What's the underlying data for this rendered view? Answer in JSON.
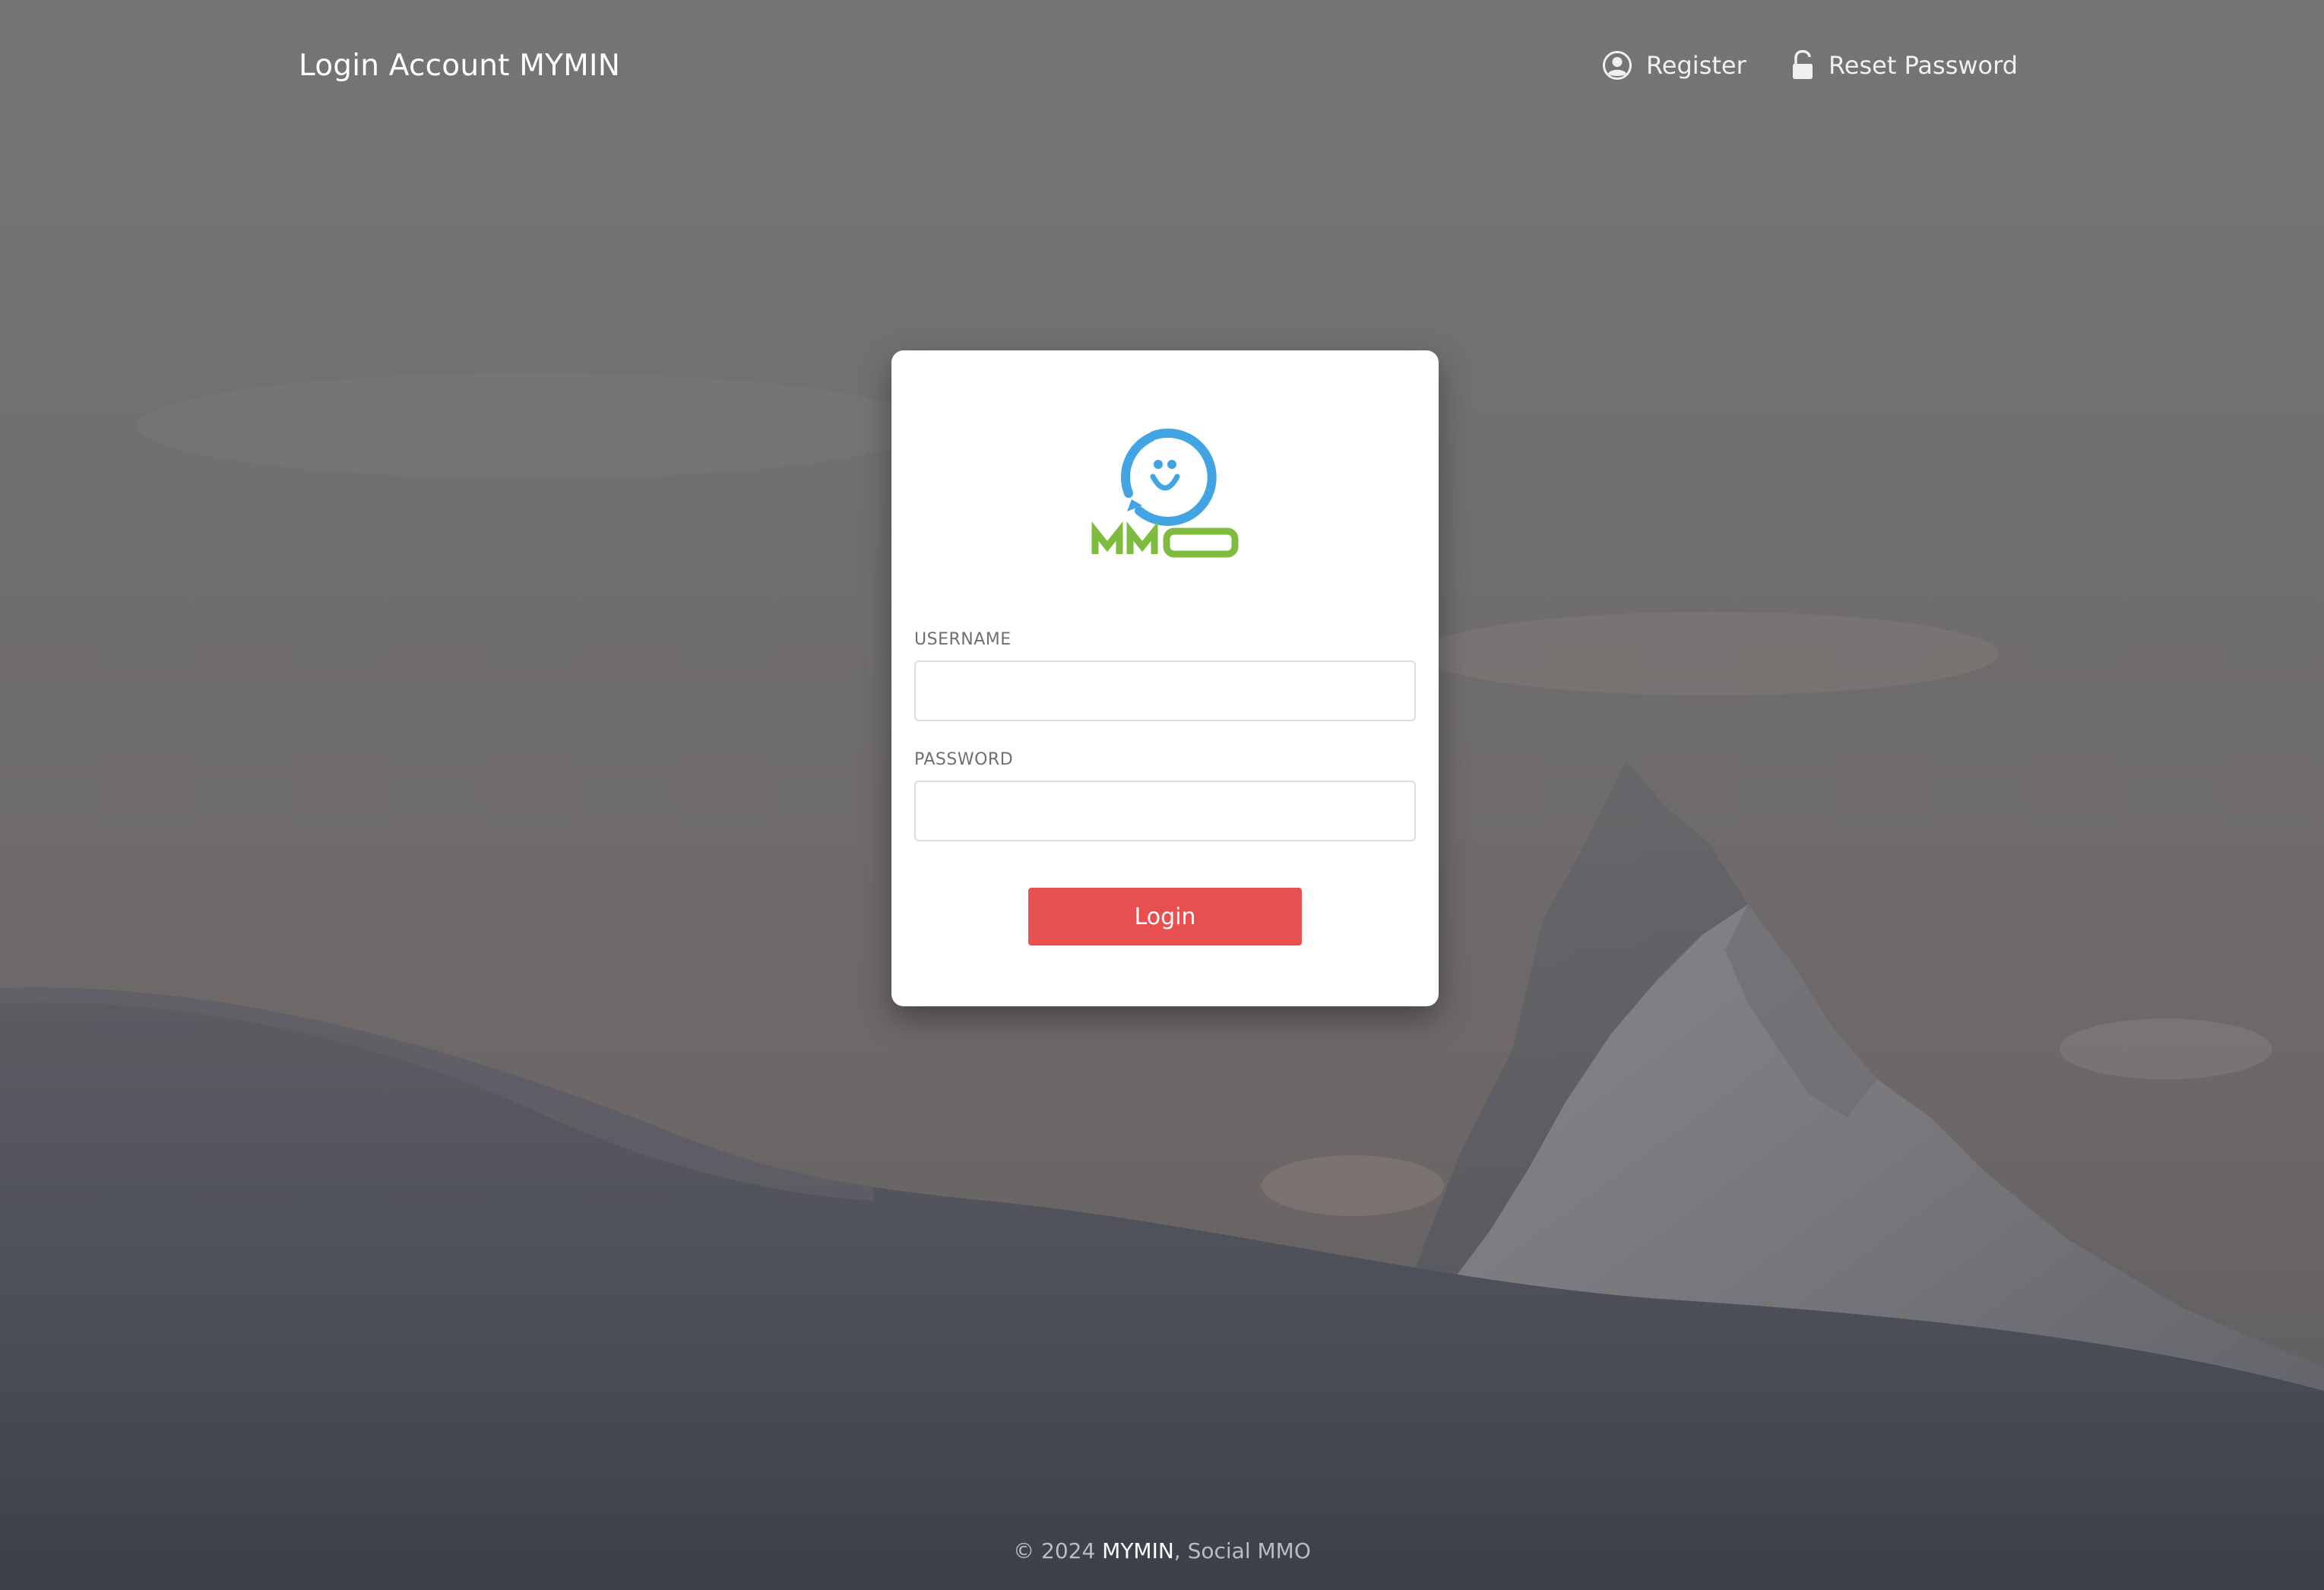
{
  "header": {
    "title": "Login Account MYMIN",
    "nav": [
      {
        "label": "Register",
        "icon": "user-circle-icon"
      },
      {
        "label": "Reset Password",
        "icon": "unlock-icon"
      }
    ]
  },
  "login_card": {
    "logo": {
      "icon": "mmo-smiley-logo",
      "text": "MMO"
    },
    "username_label": "USERNAME",
    "username_value": "",
    "password_label": "PASSWORD",
    "password_value": "",
    "submit_label": "Login"
  },
  "footer": {
    "prefix": "© 2024 ",
    "brand": "MYMIN",
    "suffix": ", Social MMO"
  },
  "colors": {
    "button": "#e84f50",
    "logo_blue": "#42a4e3",
    "logo_green": "#7fbb3e",
    "overlay": "#6e6c6c"
  }
}
